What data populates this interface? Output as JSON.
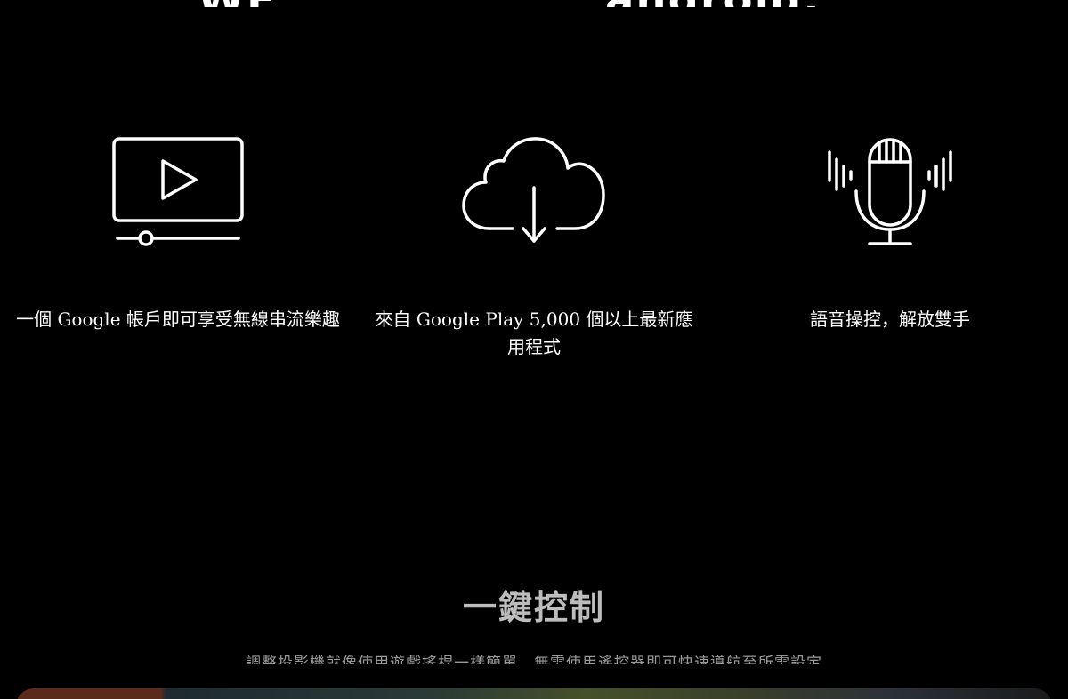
{
  "top_heading": {
    "left_text": "WE",
    "right_text": "android."
  },
  "features": [
    {
      "icon": "video-play-icon",
      "caption": "一個 Google 帳戶即可享受無線串流樂趣"
    },
    {
      "icon": "cloud-download-icon",
      "caption": "來自 Google Play 5,000 個以上最新應用程式"
    },
    {
      "icon": "voice-microphone-icon",
      "caption": "語音操控，解放雙手"
    }
  ],
  "section": {
    "title": "一鍵控制",
    "subtitle": "調整投影機就像使用遊戲搖桿一樣簡單，無需使用遙控器即可快速導航至所需設定"
  },
  "colors": {
    "background": "#000000",
    "text": "#ffffff",
    "section_title": "#bdbdbd",
    "section_subtitle": "#9a9a9a"
  }
}
